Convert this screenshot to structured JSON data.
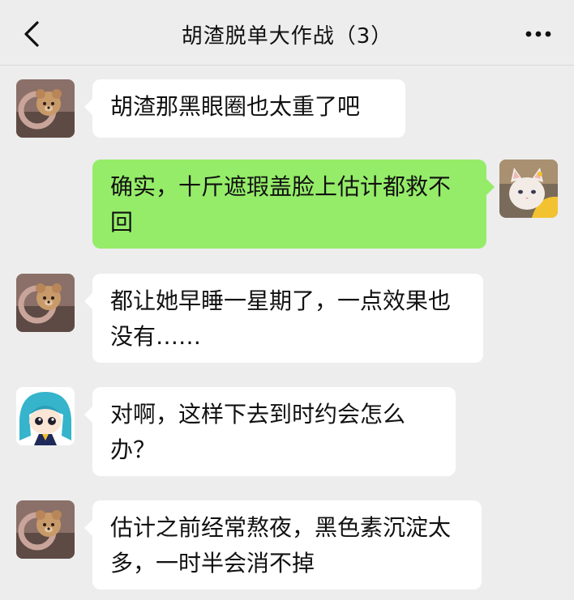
{
  "header": {
    "back_icon": "chevron-left-icon",
    "title": "胡渣脱单大作战（3）",
    "more_icon": "more-dots-icon"
  },
  "messages": [
    {
      "side": "left",
      "avatar": "bear-avatar",
      "text": "胡渣那黑眼圈也太重了吧"
    },
    {
      "side": "right",
      "avatar": "cat-avatar",
      "text": "确实，十斤遮瑕盖脸上估计都救不回"
    },
    {
      "side": "left",
      "avatar": "bear-avatar",
      "text": "都让她早睡一星期了，一点效果也没有……"
    },
    {
      "side": "left",
      "avatar": "anime-girl-avatar",
      "text": "对啊，这样下去到时约会怎么办？"
    },
    {
      "side": "left",
      "avatar": "bear-avatar",
      "text": "估计之前经常熬夜，黑色素沉淀太多，一时半会消不掉"
    }
  ],
  "colors": {
    "background": "#ededed",
    "incoming_bubble": "#ffffff",
    "outgoing_bubble": "#95ec69"
  }
}
